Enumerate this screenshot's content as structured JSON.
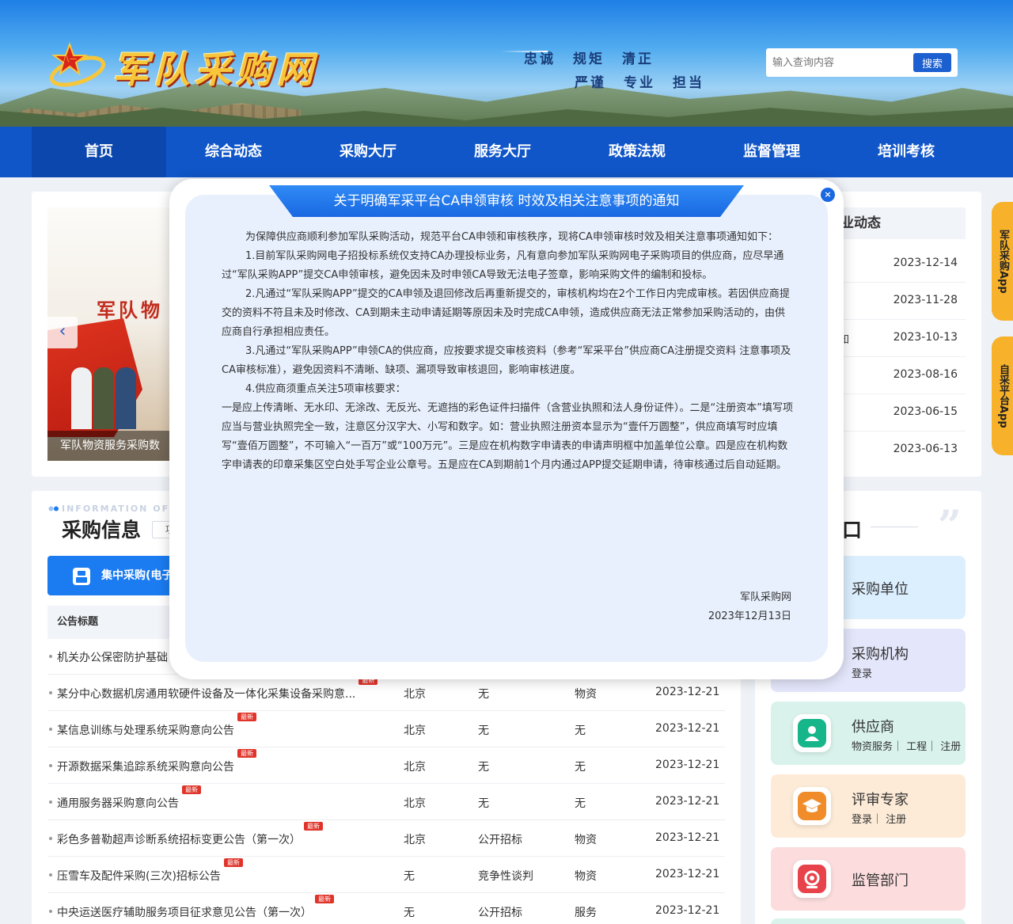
{
  "header": {
    "logo_text": "军队采购网",
    "slogan_line1": [
      "忠诚",
      "规矩",
      "清正"
    ],
    "slogan_line2": [
      "严谨",
      "专业",
      "担当"
    ],
    "search_placeholder": "输入查询内容",
    "search_button": "搜索"
  },
  "nav": {
    "items": [
      "首页",
      "综合动态",
      "采购大厅",
      "服务大厅",
      "政策法规",
      "监督管理",
      "培训考核"
    ],
    "active_index": 0
  },
  "banner": {
    "title_fragment": "军队物",
    "caption": "军队物资服务采购数",
    "prev_icon": "‹"
  },
  "news": {
    "header_fragment": "业动态",
    "rows": [
      {
        "fragment": "",
        "date": "2023-12-14"
      },
      {
        "fragment": "",
        "date": "2023-11-28"
      },
      {
        "fragment": "知",
        "date": "2023-10-13"
      },
      {
        "fragment": "",
        "date": "2023-08-16"
      },
      {
        "fragment": "",
        "date": "2023-06-15"
      },
      {
        "fragment": "",
        "date": "2023-06-13"
      }
    ]
  },
  "purchase": {
    "english_fragment": "INFORMATION OF P",
    "title": "采购信息",
    "tab_fragment": "项",
    "tab_active": "集中采购(电子",
    "column_title": "公告标题",
    "badge": "最新",
    "rows": [
      {
        "title": "机关办公保密防护基础",
        "region": "",
        "method": "",
        "type": "",
        "date": "",
        "new": false
      },
      {
        "title": "某分中心数据机房通用软硬件设备及一体化采集设备采购意...",
        "region": "北京",
        "method": "无",
        "type": "物资",
        "date": "2023-12-21",
        "new": true
      },
      {
        "title": "某信息训练与处理系统采购意向公告",
        "region": "北京",
        "method": "无",
        "type": "无",
        "date": "2023-12-21",
        "new": true
      },
      {
        "title": "开源数据采集追踪系统采购意向公告",
        "region": "北京",
        "method": "无",
        "type": "无",
        "date": "2023-12-21",
        "new": true
      },
      {
        "title": "通用服务器采购意向公告",
        "region": "北京",
        "method": "无",
        "type": "无",
        "date": "2023-12-21",
        "new": true
      },
      {
        "title": "彩色多普勒超声诊断系统招标变更公告（第一次）",
        "region": "北京",
        "method": "公开招标",
        "type": "物资",
        "date": "2023-12-21",
        "new": true
      },
      {
        "title": "压雪车及配件采购(三次)招标公告",
        "region": "无",
        "method": "竞争性谈判",
        "type": "物资",
        "date": "2023-12-21",
        "new": true
      },
      {
        "title": "中央运送医疗辅助服务项目征求意见公告（第一次）",
        "region": "无",
        "method": "公开招标",
        "type": "服务",
        "date": "2023-12-21",
        "new": true
      }
    ]
  },
  "portal": {
    "title_fragment": "口",
    "cards": [
      {
        "name": "采购单位",
        "links": "",
        "color": "#dcefff",
        "icon": "building-icon",
        "icon_color": "#3b8cf0"
      },
      {
        "name": "采购机构",
        "links": "登录",
        "color": "#e4e6fb",
        "icon": "agency-icon",
        "icon_color": "#7a7ff0"
      },
      {
        "name": "供应商",
        "links": "物资服务｜ 工程｜ 注册",
        "color": "#d9f3ec",
        "icon": "supplier-icon",
        "icon_color": "#17b58a"
      },
      {
        "name": "评审专家",
        "links": "登录｜ 注册",
        "color": "#fdebd7",
        "icon": "expert-icon",
        "icon_color": "#f08c2a"
      },
      {
        "name": "监管部门",
        "links": "",
        "color": "#fcdcdc",
        "icon": "supervisor-icon",
        "icon_color": "#e8434a"
      }
    ]
  },
  "side_tabs": [
    "军队采购App",
    "自采平台App"
  ],
  "modal": {
    "title": "关于明确军采平台CA申领审核 时效及相关注意事项的通知",
    "close_icon": "×",
    "paragraphs": [
      "为保障供应商顺利参加军队采购活动，规范平台CA申领和审核秩序，现将CA申领审核时效及相关注意事项通知如下：",
      "1.目前军队采购网电子招投标系统仅支持CA办理投标业务，凡有意向参加军队采购网电子采购项目的供应商，应尽早通过“军队采购APP”提交CA申领审核，避免因未及时申领CA导致无法电子签章，影响采购文件的编制和投标。",
      "2.凡通过“军队采购APP”提交的CA申领及退回修改后再重新提交的，审核机构均在2个工作日内完成审核。若因供应商提交的资料不符且未及时修改、CA到期未主动申请延期等原因未及时完成CA申领，造成供应商无法正常参加采购活动的，由供应商自行承担相应责任。",
      "3.凡通过“军队采购APP”申领CA的供应商，应按要求提交审核资料（参考“军采平台”供应商CA注册提交资料 注意事项及CA审核标准），避免因资料不清晰、缺项、漏项导致审核退回，影响审核进度。",
      "4.供应商须重点关注5项审核要求：",
      "一是应上传清晰、无水印、无涂改、无反光、无遮挡的彩色证件扫描件（含营业执照和法人身份证件）。二是“注册资本”填写项应当与营业执照完全一致，注意区分汉字大、小写和数字。如：营业执照注册资本显示为“壹仟万圆整”，供应商填写时应填写“壹佰万圆整”，不可输入“一百万”或“100万元”。三是应在机构数字申请表的申请声明框中加盖单位公章。四是应在机构数字申请表的印章采集区空白处手写企业公章号。五是应在CA到期前1个月内通过APP提交延期申请，待审核通过后自动延期。"
    ],
    "signature": "军队采购网",
    "date": "2023年12月13日"
  }
}
